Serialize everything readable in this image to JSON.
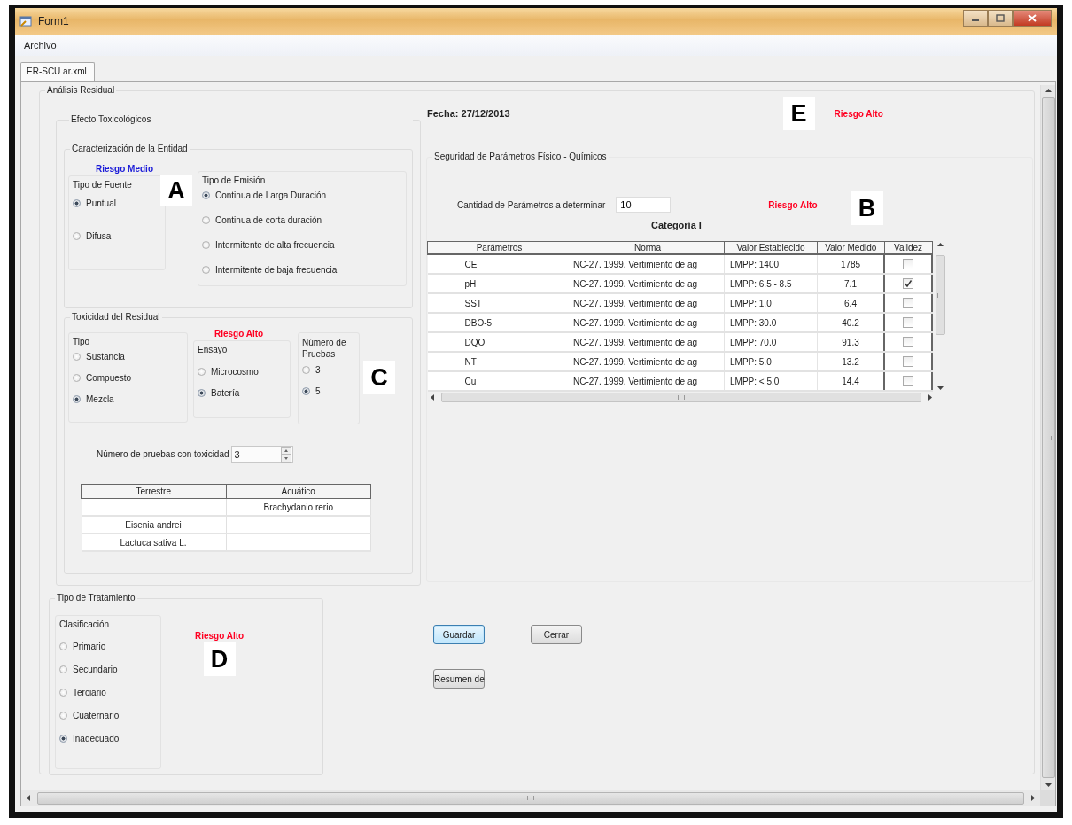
{
  "window": {
    "title": "Form1"
  },
  "menu": [
    {
      "label": "Archivo"
    }
  ],
  "tabs": [
    {
      "label": "ER-SCU ar.xml",
      "selected": true
    }
  ],
  "analysis": {
    "title": "Análisis Residual",
    "date": "Fecha: 27/12/2013",
    "marker": "E",
    "risk": {
      "text": "Riesgo Alto",
      "kind": "high"
    }
  },
  "toxic_effects": {
    "title": "Efecto Toxicológicos",
    "entity": {
      "title": "Caracterización de la Entidad",
      "risk": {
        "text": "Riesgo Medio",
        "kind": "medium"
      },
      "source_type": {
        "title": "Tipo de Fuente",
        "marker": "A",
        "options": [
          {
            "label": "Puntual",
            "selected": true
          },
          {
            "label": "Difusa",
            "selected": false
          }
        ]
      },
      "emission_type": {
        "title": "Tipo de Emisión",
        "options": [
          {
            "label": "Continua de Larga Duración",
            "selected": true
          },
          {
            "label": "Continua de corta duración",
            "selected": false
          },
          {
            "label": "Intermitente de alta frecuencia",
            "selected": false
          },
          {
            "label": "Intermitente de baja frecuencia",
            "selected": false
          }
        ]
      }
    },
    "toxicity": {
      "title": "Toxicidad del Residual",
      "type": {
        "title": "Tipo",
        "options": [
          {
            "label": "Sustancia",
            "selected": false
          },
          {
            "label": "Compuesto",
            "selected": false
          },
          {
            "label": "Mezcla",
            "selected": true
          }
        ]
      },
      "risk": {
        "text": "Riesgo Alto",
        "kind": "high"
      },
      "assay": {
        "title": "Ensayo",
        "options": [
          {
            "label": "Microcosmo",
            "selected": false
          },
          {
            "label": "Batería",
            "selected": true
          }
        ]
      },
      "tests": {
        "title": "Número de Pruebas",
        "marker": "C",
        "options": [
          {
            "label": "3",
            "selected": false
          },
          {
            "label": "5",
            "selected": true
          }
        ]
      },
      "toxic_tests": {
        "label": "Número de pruebas con toxicidad",
        "value": "3"
      },
      "species_table": {
        "columns": [
          "Terrestre",
          "Acuático"
        ],
        "rows": [
          [
            null,
            "Brachydanio rerio"
          ],
          [
            "Eisenia andrei",
            null
          ],
          [
            "Lactuca sativa L.",
            null
          ]
        ]
      }
    }
  },
  "physchem": {
    "title": "Seguridad de Parámetros Físico - Químicos",
    "count_label": "Cantidad de Parámetros a determinar",
    "count_value": "10",
    "risk": {
      "text": "Riesgo Alto",
      "kind": "high"
    },
    "marker": "B",
    "table_title": "Categoría I",
    "columns": [
      "Parámetros",
      "Norma",
      "Valor Establecido",
      "Valor Medido",
      "Validez"
    ],
    "rows": [
      {
        "parameter": "CE",
        "norm": "NC-27. 1999. Vertimiento de ag",
        "limit": "LMPP: 1400",
        "measured": "1785",
        "checked": false
      },
      {
        "parameter": "pH",
        "norm": "NC-27. 1999. Vertimiento de ag",
        "limit": "LMPP: 6.5 - 8.5",
        "measured": "7.1",
        "checked": true
      },
      {
        "parameter": "SST",
        "norm": "NC-27. 1999. Vertimiento de ag",
        "limit": "LMPP: 1.0",
        "measured": "6.4",
        "checked": false
      },
      {
        "parameter": "DBO-5",
        "norm": "NC-27. 1999. Vertimiento de ag",
        "limit": "LMPP: 30.0",
        "measured": "40.2",
        "checked": false
      },
      {
        "parameter": "DQO",
        "norm": "NC-27. 1999. Vertimiento de ag",
        "limit": "LMPP: 70.0",
        "measured": "91.3",
        "checked": false
      },
      {
        "parameter": "NT",
        "norm": "NC-27. 1999. Vertimiento de ag",
        "limit": "LMPP: 5.0",
        "measured": "13.2",
        "checked": false
      },
      {
        "parameter": "Cu",
        "norm": "NC-27. 1999. Vertimiento de ag",
        "limit": "LMPP: < 5.0",
        "measured": "14.4",
        "checked": false
      }
    ]
  },
  "treatment": {
    "title": "Tipo de Tratamiento",
    "classification": {
      "title": "Clasificación",
      "options": [
        {
          "label": "Primario",
          "selected": false
        },
        {
          "label": "Secundario",
          "selected": false
        },
        {
          "label": "Terciario",
          "selected": false
        },
        {
          "label": "Cuaternario",
          "selected": false
        },
        {
          "label": "Inadecuado",
          "selected": true
        }
      ]
    },
    "risk": {
      "text": "Riesgo Alto",
      "kind": "high"
    },
    "marker": "D"
  },
  "buttons": [
    {
      "label": "Guardar",
      "focused": true
    },
    {
      "label": "Cerrar",
      "focused": false
    },
    {
      "label": "Resumen de",
      "focused": false
    }
  ]
}
